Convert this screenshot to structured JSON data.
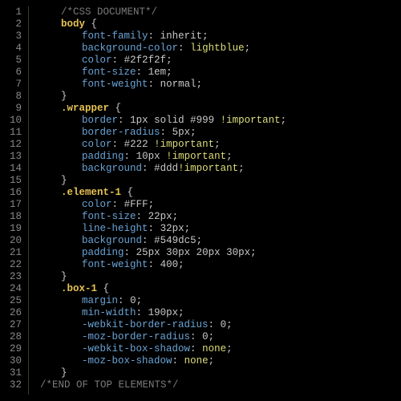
{
  "editor": {
    "language": "css",
    "line_count": 32,
    "lines": [
      {
        "n": 1,
        "text": "/*CSS DOCUMENT*/",
        "type": "comment",
        "indent": 1
      },
      {
        "n": 2,
        "selector": "body",
        "brace": "{",
        "type": "sel-open",
        "indent": 1
      },
      {
        "n": 3,
        "prop": "font-family",
        "val": "inherit",
        "important": false,
        "indent": 2
      },
      {
        "n": 4,
        "prop": "background-color",
        "val": "lightblue",
        "val_hl": true,
        "indent": 2
      },
      {
        "n": 5,
        "prop": "color",
        "val": "#2f2f2f",
        "indent": 2
      },
      {
        "n": 6,
        "prop": "font-size",
        "val": "1em",
        "indent": 2
      },
      {
        "n": 7,
        "prop": "font-weight",
        "val": "normal",
        "indent": 2
      },
      {
        "n": 8,
        "brace": "}",
        "type": "close",
        "indent": 1
      },
      {
        "n": 9,
        "selector": ".wrapper",
        "brace": "{",
        "type": "sel-open",
        "indent": 1
      },
      {
        "n": 10,
        "prop": "border",
        "val": "1px solid #999",
        "important": true,
        "indent": 2
      },
      {
        "n": 11,
        "prop": "border-radius",
        "val": "5px",
        "indent": 2
      },
      {
        "n": 12,
        "prop": "color",
        "val": "#222",
        "important": true,
        "indent": 2
      },
      {
        "n": 13,
        "prop": "padding",
        "val": "10px",
        "important": true,
        "indent": 2
      },
      {
        "n": 14,
        "prop": "background",
        "val": "#ddd",
        "important": true,
        "important_nospace": true,
        "indent": 2
      },
      {
        "n": 15,
        "brace": "}",
        "type": "close",
        "indent": 1
      },
      {
        "n": 16,
        "selector": ".element-1",
        "brace": "{",
        "type": "sel-open",
        "indent": 1
      },
      {
        "n": 17,
        "prop": "color",
        "val": "#FFF",
        "indent": 2
      },
      {
        "n": 18,
        "prop": "font-size",
        "val": "22px",
        "indent": 2
      },
      {
        "n": 19,
        "prop": "line-height",
        "val": "32px",
        "indent": 2
      },
      {
        "n": 20,
        "prop": "background",
        "val": "#549dc5",
        "indent": 2
      },
      {
        "n": 21,
        "prop": "padding",
        "val": "25px 30px 20px 30px",
        "indent": 2
      },
      {
        "n": 22,
        "prop": "font-weight",
        "val": "400",
        "indent": 2
      },
      {
        "n": 23,
        "brace": "}",
        "type": "close",
        "indent": 1
      },
      {
        "n": 24,
        "selector": ".box-1",
        "brace": "{",
        "type": "sel-open",
        "indent": 1
      },
      {
        "n": 25,
        "prop": "margin",
        "val": "0",
        "indent": 2
      },
      {
        "n": 26,
        "prop": "min-width",
        "val": "190px",
        "indent": 2
      },
      {
        "n": 27,
        "prop": "-webkit-border-radius",
        "val": "0",
        "indent": 2
      },
      {
        "n": 28,
        "prop": "-moz-border-radius",
        "val": "0",
        "indent": 2
      },
      {
        "n": 29,
        "prop": "-webkit-box-shadow",
        "val": "none",
        "val_hl": true,
        "indent": 2
      },
      {
        "n": 30,
        "prop": "-moz-box-shadow",
        "val": "none",
        "val_hl": true,
        "indent": 2
      },
      {
        "n": 31,
        "brace": "}",
        "type": "close",
        "indent": 1
      },
      {
        "n": 32,
        "text": "/*END OF TOP ELEMENTS*/",
        "type": "comment",
        "indent": 0
      }
    ]
  }
}
